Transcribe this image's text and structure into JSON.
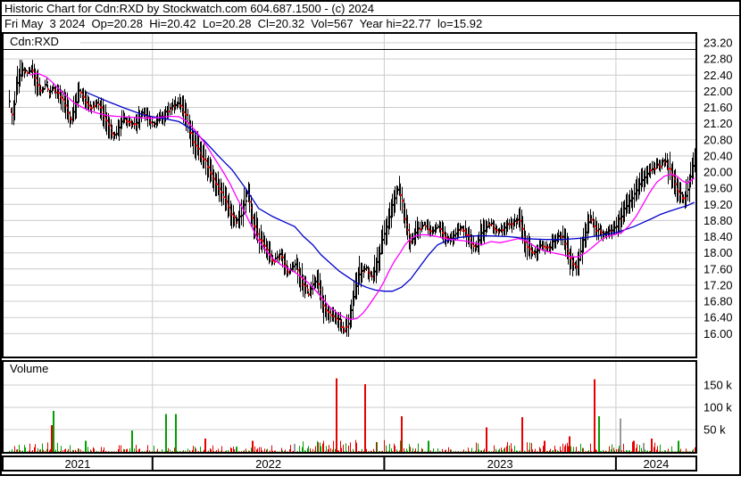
{
  "header": {
    "title": "Historic Chart for Cdn:RXD by Stockwatch.com 604.687.1500 - (c) 2024",
    "quote_line": "Fri May  3 2024  Op=20.28  Hi=20.42  Lo=20.28  Cl=20.32  Vol=567  Year hi=22.77  lo=15.92"
  },
  "panels": {
    "symbol_label": "Cdn:RXD",
    "volume_label": "Volume"
  },
  "chart_data": {
    "type": "candlestick",
    "symbol": "Cdn:RXD",
    "title": "Historic Chart for Cdn:RXD",
    "last_quote": {
      "date": "Fri May 3 2024",
      "open": 20.28,
      "high": 20.42,
      "low": 20.28,
      "close": 20.32,
      "volume": 567,
      "year_high": 22.77,
      "year_low": 15.92
    },
    "price_axis": {
      "side": "right",
      "min": 16.0,
      "max": 23.2,
      "step": 0.4,
      "tick_labels": [
        "23.20",
        "22.80",
        "22.40",
        "22.00",
        "21.60",
        "21.20",
        "20.80",
        "20.40",
        "20.00",
        "19.60",
        "19.20",
        "18.80",
        "18.40",
        "18.00",
        "17.60",
        "17.20",
        "16.80",
        "16.40",
        "16.00"
      ]
    },
    "volume_axis": {
      "tick_labels": [
        "150 k",
        "100 k",
        "50 k"
      ],
      "tick_values_k": [
        150,
        100,
        50
      ]
    },
    "x_axis": {
      "year_labels": [
        "2021",
        "2022",
        "2023",
        "2024"
      ],
      "year_boundaries_t": [
        0.216,
        0.55,
        0.884
      ]
    },
    "series": {
      "close_path": [
        [
          0.009,
          21.7
        ],
        [
          0.014,
          21.35
        ],
        [
          0.022,
          22.3
        ],
        [
          0.028,
          22.55
        ],
        [
          0.035,
          22.45
        ],
        [
          0.041,
          22.6
        ],
        [
          0.048,
          22.3
        ],
        [
          0.055,
          22.0
        ],
        [
          0.063,
          22.2
        ],
        [
          0.067,
          21.9
        ],
        [
          0.073,
          22.1
        ],
        [
          0.081,
          21.9
        ],
        [
          0.089,
          21.75
        ],
        [
          0.097,
          21.3
        ],
        [
          0.104,
          21.5
        ],
        [
          0.109,
          22.0
        ],
        [
          0.118,
          21.8
        ],
        [
          0.125,
          21.6
        ],
        [
          0.138,
          21.7
        ],
        [
          0.151,
          21.2
        ],
        [
          0.161,
          20.9
        ],
        [
          0.174,
          21.3
        ],
        [
          0.189,
          21.15
        ],
        [
          0.202,
          21.5
        ],
        [
          0.216,
          21.2
        ],
        [
          0.228,
          21.35
        ],
        [
          0.243,
          21.6
        ],
        [
          0.254,
          21.75
        ],
        [
          0.264,
          21.4
        ],
        [
          0.274,
          20.8
        ],
        [
          0.284,
          20.5
        ],
        [
          0.295,
          20.15
        ],
        [
          0.305,
          19.8
        ],
        [
          0.315,
          19.5
        ],
        [
          0.326,
          19.1
        ],
        [
          0.336,
          18.75
        ],
        [
          0.344,
          18.9
        ],
        [
          0.353,
          19.55
        ],
        [
          0.36,
          18.8
        ],
        [
          0.369,
          18.35
        ],
        [
          0.38,
          18.1
        ],
        [
          0.39,
          17.8
        ],
        [
          0.4,
          17.95
        ],
        [
          0.411,
          17.55
        ],
        [
          0.421,
          17.75
        ],
        [
          0.431,
          17.3
        ],
        [
          0.441,
          17.0
        ],
        [
          0.452,
          17.35
        ],
        [
          0.462,
          16.7
        ],
        [
          0.472,
          16.5
        ],
        [
          0.483,
          16.35
        ],
        [
          0.492,
          16.1
        ],
        [
          0.498,
          16.25
        ],
        [
          0.507,
          17.0
        ],
        [
          0.515,
          17.5
        ],
        [
          0.524,
          17.6
        ],
        [
          0.533,
          17.4
        ],
        [
          0.542,
          17.9
        ],
        [
          0.552,
          18.6
        ],
        [
          0.562,
          19.2
        ],
        [
          0.571,
          19.7
        ],
        [
          0.579,
          18.9
        ],
        [
          0.588,
          18.25
        ],
        [
          0.598,
          18.6
        ],
        [
          0.609,
          18.7
        ],
        [
          0.619,
          18.5
        ],
        [
          0.629,
          18.65
        ],
        [
          0.64,
          18.3
        ],
        [
          0.65,
          18.4
        ],
        [
          0.66,
          18.6
        ],
        [
          0.671,
          18.45
        ],
        [
          0.681,
          18.1
        ],
        [
          0.691,
          18.5
        ],
        [
          0.701,
          18.75
        ],
        [
          0.712,
          18.55
        ],
        [
          0.722,
          18.6
        ],
        [
          0.732,
          18.75
        ],
        [
          0.745,
          18.85
        ],
        [
          0.755,
          18.2
        ],
        [
          0.766,
          17.95
        ],
        [
          0.776,
          18.25
        ],
        [
          0.786,
          18.1
        ],
        [
          0.797,
          18.35
        ],
        [
          0.807,
          18.4
        ],
        [
          0.817,
          17.9
        ],
        [
          0.827,
          17.6
        ],
        [
          0.838,
          18.4
        ],
        [
          0.846,
          18.85
        ],
        [
          0.856,
          18.6
        ],
        [
          0.866,
          18.45
        ],
        [
          0.876,
          18.55
        ],
        [
          0.884,
          18.65
        ],
        [
          0.894,
          19.0
        ],
        [
          0.905,
          19.3
        ],
        [
          0.915,
          19.6
        ],
        [
          0.925,
          19.9
        ],
        [
          0.936,
          20.1
        ],
        [
          0.946,
          20.15
        ],
        [
          0.954,
          20.3
        ],
        [
          0.964,
          19.95
        ],
        [
          0.974,
          19.5
        ],
        [
          0.984,
          19.3
        ],
        [
          0.991,
          19.9
        ],
        [
          0.997,
          20.32
        ]
      ],
      "ma_fast": {
        "name": "short-term moving average",
        "color": "#ff00ff",
        "points": [
          [
            0.039,
            22.4
          ],
          [
            0.05,
            22.45
          ],
          [
            0.063,
            22.35
          ],
          [
            0.073,
            22.2
          ],
          [
            0.084,
            22.0
          ],
          [
            0.094,
            21.85
          ],
          [
            0.104,
            21.7
          ],
          [
            0.115,
            21.6
          ],
          [
            0.125,
            21.52
          ],
          [
            0.138,
            21.45
          ],
          [
            0.151,
            21.4
          ],
          [
            0.163,
            21.38
          ],
          [
            0.183,
            21.36
          ],
          [
            0.202,
            21.34
          ],
          [
            0.216,
            21.33
          ],
          [
            0.228,
            21.36
          ],
          [
            0.241,
            21.38
          ],
          [
            0.254,
            21.37
          ],
          [
            0.266,
            21.25
          ],
          [
            0.279,
            21.0
          ],
          [
            0.292,
            20.7
          ],
          [
            0.305,
            20.35
          ],
          [
            0.318,
            20.0
          ],
          [
            0.328,
            19.7
          ],
          [
            0.338,
            19.35
          ],
          [
            0.349,
            19.0
          ],
          [
            0.359,
            18.65
          ],
          [
            0.369,
            18.3
          ],
          [
            0.38,
            18.05
          ],
          [
            0.39,
            17.85
          ],
          [
            0.4,
            17.72
          ],
          [
            0.411,
            17.62
          ],
          [
            0.421,
            17.52
          ],
          [
            0.431,
            17.4
          ],
          [
            0.441,
            17.25
          ],
          [
            0.452,
            17.05
          ],
          [
            0.462,
            16.85
          ],
          [
            0.472,
            16.65
          ],
          [
            0.483,
            16.5
          ],
          [
            0.493,
            16.4
          ],
          [
            0.503,
            16.35
          ],
          [
            0.511,
            16.38
          ],
          [
            0.519,
            16.5
          ],
          [
            0.526,
            16.65
          ],
          [
            0.534,
            16.85
          ],
          [
            0.542,
            17.05
          ],
          [
            0.55,
            17.3
          ],
          [
            0.557,
            17.55
          ],
          [
            0.565,
            17.8
          ],
          [
            0.573,
            18.0
          ],
          [
            0.58,
            18.2
          ],
          [
            0.588,
            18.35
          ],
          [
            0.596,
            18.42
          ],
          [
            0.604,
            18.45
          ],
          [
            0.614,
            18.44
          ],
          [
            0.627,
            18.4
          ],
          [
            0.64,
            18.35
          ],
          [
            0.653,
            18.32
          ],
          [
            0.665,
            18.3
          ],
          [
            0.678,
            18.25
          ],
          [
            0.691,
            18.2
          ],
          [
            0.704,
            18.28
          ],
          [
            0.717,
            18.25
          ],
          [
            0.73,
            18.3
          ],
          [
            0.743,
            18.35
          ],
          [
            0.755,
            18.3
          ],
          [
            0.768,
            18.15
          ],
          [
            0.781,
            18.05
          ],
          [
            0.794,
            18.0
          ],
          [
            0.807,
            17.95
          ],
          [
            0.82,
            17.9
          ],
          [
            0.83,
            17.9
          ],
          [
            0.84,
            18.0
          ],
          [
            0.851,
            18.15
          ],
          [
            0.861,
            18.3
          ],
          [
            0.871,
            18.4
          ],
          [
            0.882,
            18.45
          ],
          [
            0.892,
            18.5
          ],
          [
            0.902,
            18.65
          ],
          [
            0.913,
            18.9
          ],
          [
            0.923,
            19.2
          ],
          [
            0.933,
            19.5
          ],
          [
            0.943,
            19.75
          ],
          [
            0.954,
            19.9
          ],
          [
            0.964,
            19.95
          ],
          [
            0.972,
            19.9
          ],
          [
            0.98,
            19.78
          ],
          [
            0.987,
            19.72
          ],
          [
            0.997,
            19.85
          ]
        ]
      },
      "ma_slow": {
        "name": "long-term moving average",
        "color": "#0000cc",
        "points": [
          [
            0.121,
            21.97
          ],
          [
            0.151,
            21.75
          ],
          [
            0.176,
            21.58
          ],
          [
            0.202,
            21.42
          ],
          [
            0.216,
            21.37
          ],
          [
            0.234,
            21.32
          ],
          [
            0.254,
            21.25
          ],
          [
            0.273,
            21.05
          ],
          [
            0.292,
            20.75
          ],
          [
            0.311,
            20.4
          ],
          [
            0.331,
            20.05
          ],
          [
            0.35,
            19.6
          ],
          [
            0.369,
            19.1
          ],
          [
            0.389,
            18.9
          ],
          [
            0.408,
            18.75
          ],
          [
            0.421,
            18.65
          ],
          [
            0.434,
            18.4
          ],
          [
            0.447,
            18.2
          ],
          [
            0.459,
            17.95
          ],
          [
            0.472,
            17.75
          ],
          [
            0.485,
            17.55
          ],
          [
            0.498,
            17.4
          ],
          [
            0.511,
            17.25
          ],
          [
            0.524,
            17.15
          ],
          [
            0.537,
            17.08
          ],
          [
            0.55,
            17.05
          ],
          [
            0.562,
            17.05
          ],
          [
            0.575,
            17.15
          ],
          [
            0.588,
            17.35
          ],
          [
            0.601,
            17.65
          ],
          [
            0.614,
            17.95
          ],
          [
            0.627,
            18.2
          ],
          [
            0.64,
            18.3
          ],
          [
            0.659,
            18.38
          ],
          [
            0.678,
            18.42
          ],
          [
            0.704,
            18.42
          ],
          [
            0.73,
            18.4
          ],
          [
            0.755,
            18.35
          ],
          [
            0.781,
            18.33
          ],
          [
            0.807,
            18.33
          ],
          [
            0.833,
            18.36
          ],
          [
            0.858,
            18.42
          ],
          [
            0.884,
            18.5
          ],
          [
            0.897,
            18.57
          ],
          [
            0.91,
            18.65
          ],
          [
            0.923,
            18.75
          ],
          [
            0.936,
            18.85
          ],
          [
            0.948,
            18.95
          ],
          [
            0.961,
            19.03
          ],
          [
            0.974,
            19.1
          ],
          [
            0.987,
            19.17
          ],
          [
            0.997,
            19.25
          ]
        ]
      },
      "volume_spikes_k": [
        [
          0.071,
          60,
          "d"
        ],
        [
          0.073,
          92,
          "u"
        ],
        [
          0.12,
          25,
          "u"
        ],
        [
          0.187,
          48,
          "u"
        ],
        [
          0.236,
          85,
          "u"
        ],
        [
          0.25,
          85,
          "u"
        ],
        [
          0.292,
          30,
          "d"
        ],
        [
          0.36,
          25,
          "d"
        ],
        [
          0.421,
          18,
          "n"
        ],
        [
          0.481,
          165,
          "d"
        ],
        [
          0.523,
          152,
          "d"
        ],
        [
          0.575,
          80,
          "d"
        ],
        [
          0.614,
          25,
          "u"
        ],
        [
          0.698,
          55,
          "d"
        ],
        [
          0.749,
          78,
          "d"
        ],
        [
          0.781,
          25,
          "d"
        ],
        [
          0.817,
          35,
          "d"
        ],
        [
          0.853,
          163,
          "d"
        ],
        [
          0.86,
          80,
          "u"
        ],
        [
          0.891,
          75,
          "n"
        ],
        [
          0.91,
          25,
          "d"
        ],
        [
          0.924,
          20,
          "n"
        ],
        [
          0.936,
          30,
          "d"
        ],
        [
          0.974,
          25,
          "u"
        ]
      ]
    },
    "colors": {
      "bar": "#000000",
      "down_tick": "#ff0000",
      "vol_up": "#00a000",
      "vol_down": "#e60000",
      "vol_neutral": "#999999",
      "grid": "#cccccc",
      "frame": "#000000"
    }
  }
}
